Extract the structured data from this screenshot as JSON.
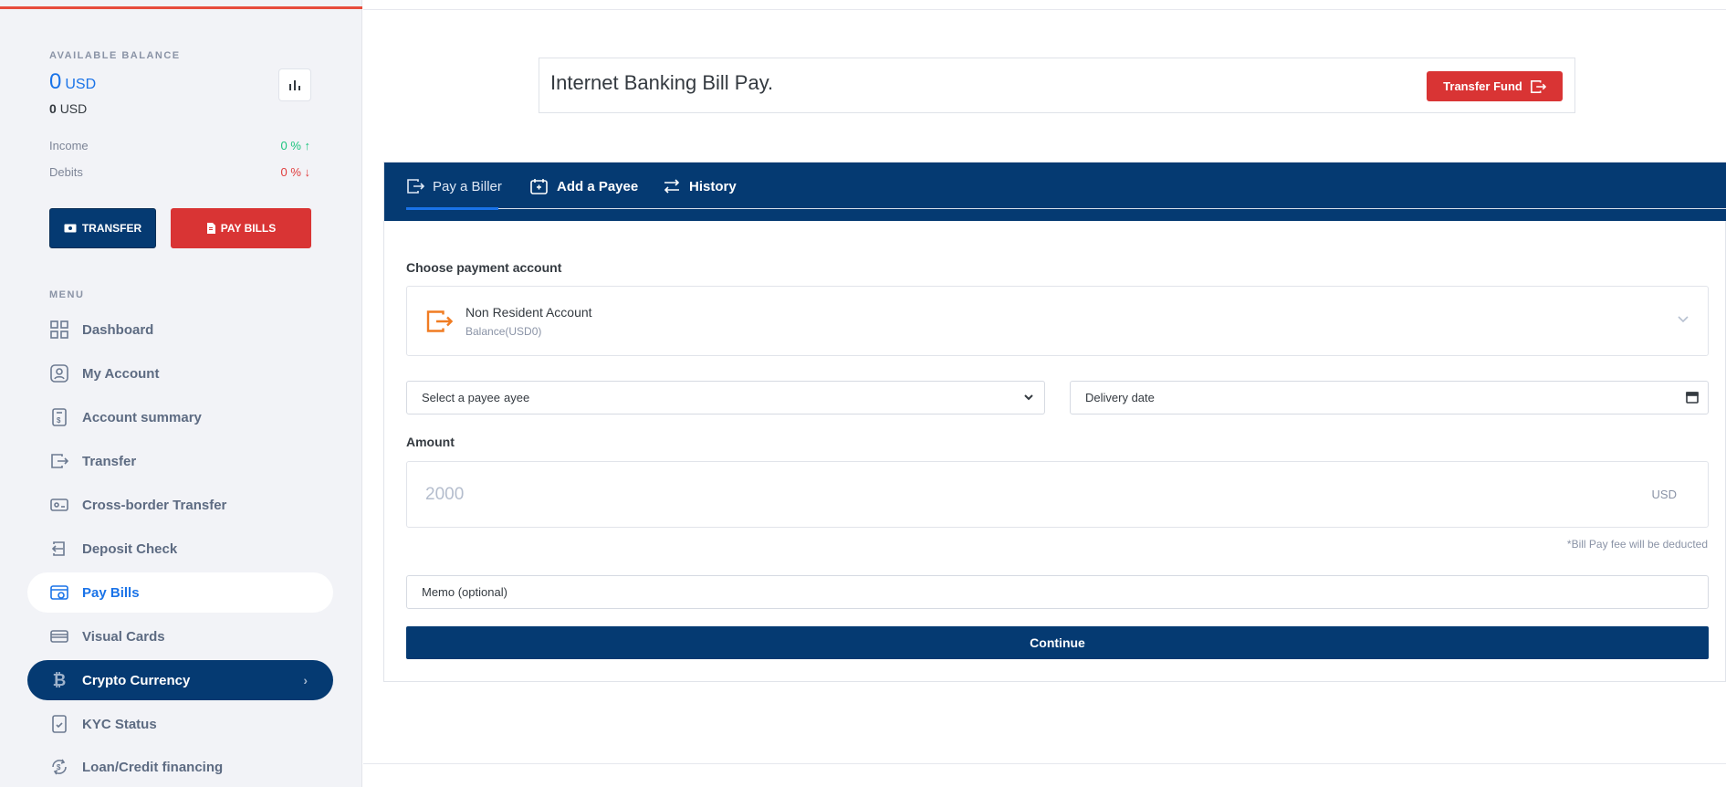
{
  "sidebar": {
    "balance_title": "AVAILABLE BALANCE",
    "balance_value": "0",
    "balance_currency": "USD",
    "balance_sub_value": "0",
    "balance_sub_currency": "USD",
    "income_label": "Income",
    "income_value": "0 % ↑",
    "debits_label": "Debits",
    "debits_value": "0 % ↓",
    "transfer_button": "TRANSFER",
    "paybills_button": "PAY BILLS",
    "menu_title": "MENU",
    "items": [
      {
        "label": "Dashboard",
        "icon": "grid-icon"
      },
      {
        "label": "My Account",
        "icon": "user-icon"
      },
      {
        "label": "Account summary",
        "icon": "document-dollar-icon"
      },
      {
        "label": "Transfer",
        "icon": "transfer-out-icon"
      },
      {
        "label": "Cross-border Transfer",
        "icon": "money-icon"
      },
      {
        "label": "Deposit Check",
        "icon": "deposit-icon"
      },
      {
        "label": "Pay Bills",
        "icon": "bill-icon"
      },
      {
        "label": "Visual Cards",
        "icon": "card-icon"
      },
      {
        "label": "Crypto Currency",
        "icon": "bitcoin-icon"
      },
      {
        "label": "KYC Status",
        "icon": "kyc-icon"
      },
      {
        "label": "Loan/Credit financing",
        "icon": "loan-icon"
      }
    ]
  },
  "header": {
    "title": "Internet Banking Bill Pay.",
    "transfer_fund_button": "Transfer Fund"
  },
  "tabs": [
    {
      "label": "Pay a Biller",
      "icon": "wallet-out-icon"
    },
    {
      "label": "Add a Payee",
      "icon": "add-payee-icon"
    },
    {
      "label": "History",
      "icon": "swap-icon"
    }
  ],
  "form": {
    "choose_account_label": "Choose payment account",
    "account_name": "Non Resident Account",
    "account_balance": "Balance(USD0)",
    "payee_select": "Select a payee",
    "payee_overflow_text": "ayee",
    "delivery_date_placeholder": "Delivery date",
    "amount_label": "Amount",
    "amount_placeholder": "2000",
    "amount_unit": "USD",
    "fee_note": "*Bill Pay fee will be deducted",
    "memo_placeholder": "Memo (optional)",
    "continue_button": "Continue"
  },
  "colors": {
    "primary": "#053a72",
    "accent_red": "#d93434",
    "link_blue": "#1a73e8",
    "positive": "#1bc47d",
    "negative": "#e03c3c",
    "account_icon": "#f07c22"
  }
}
